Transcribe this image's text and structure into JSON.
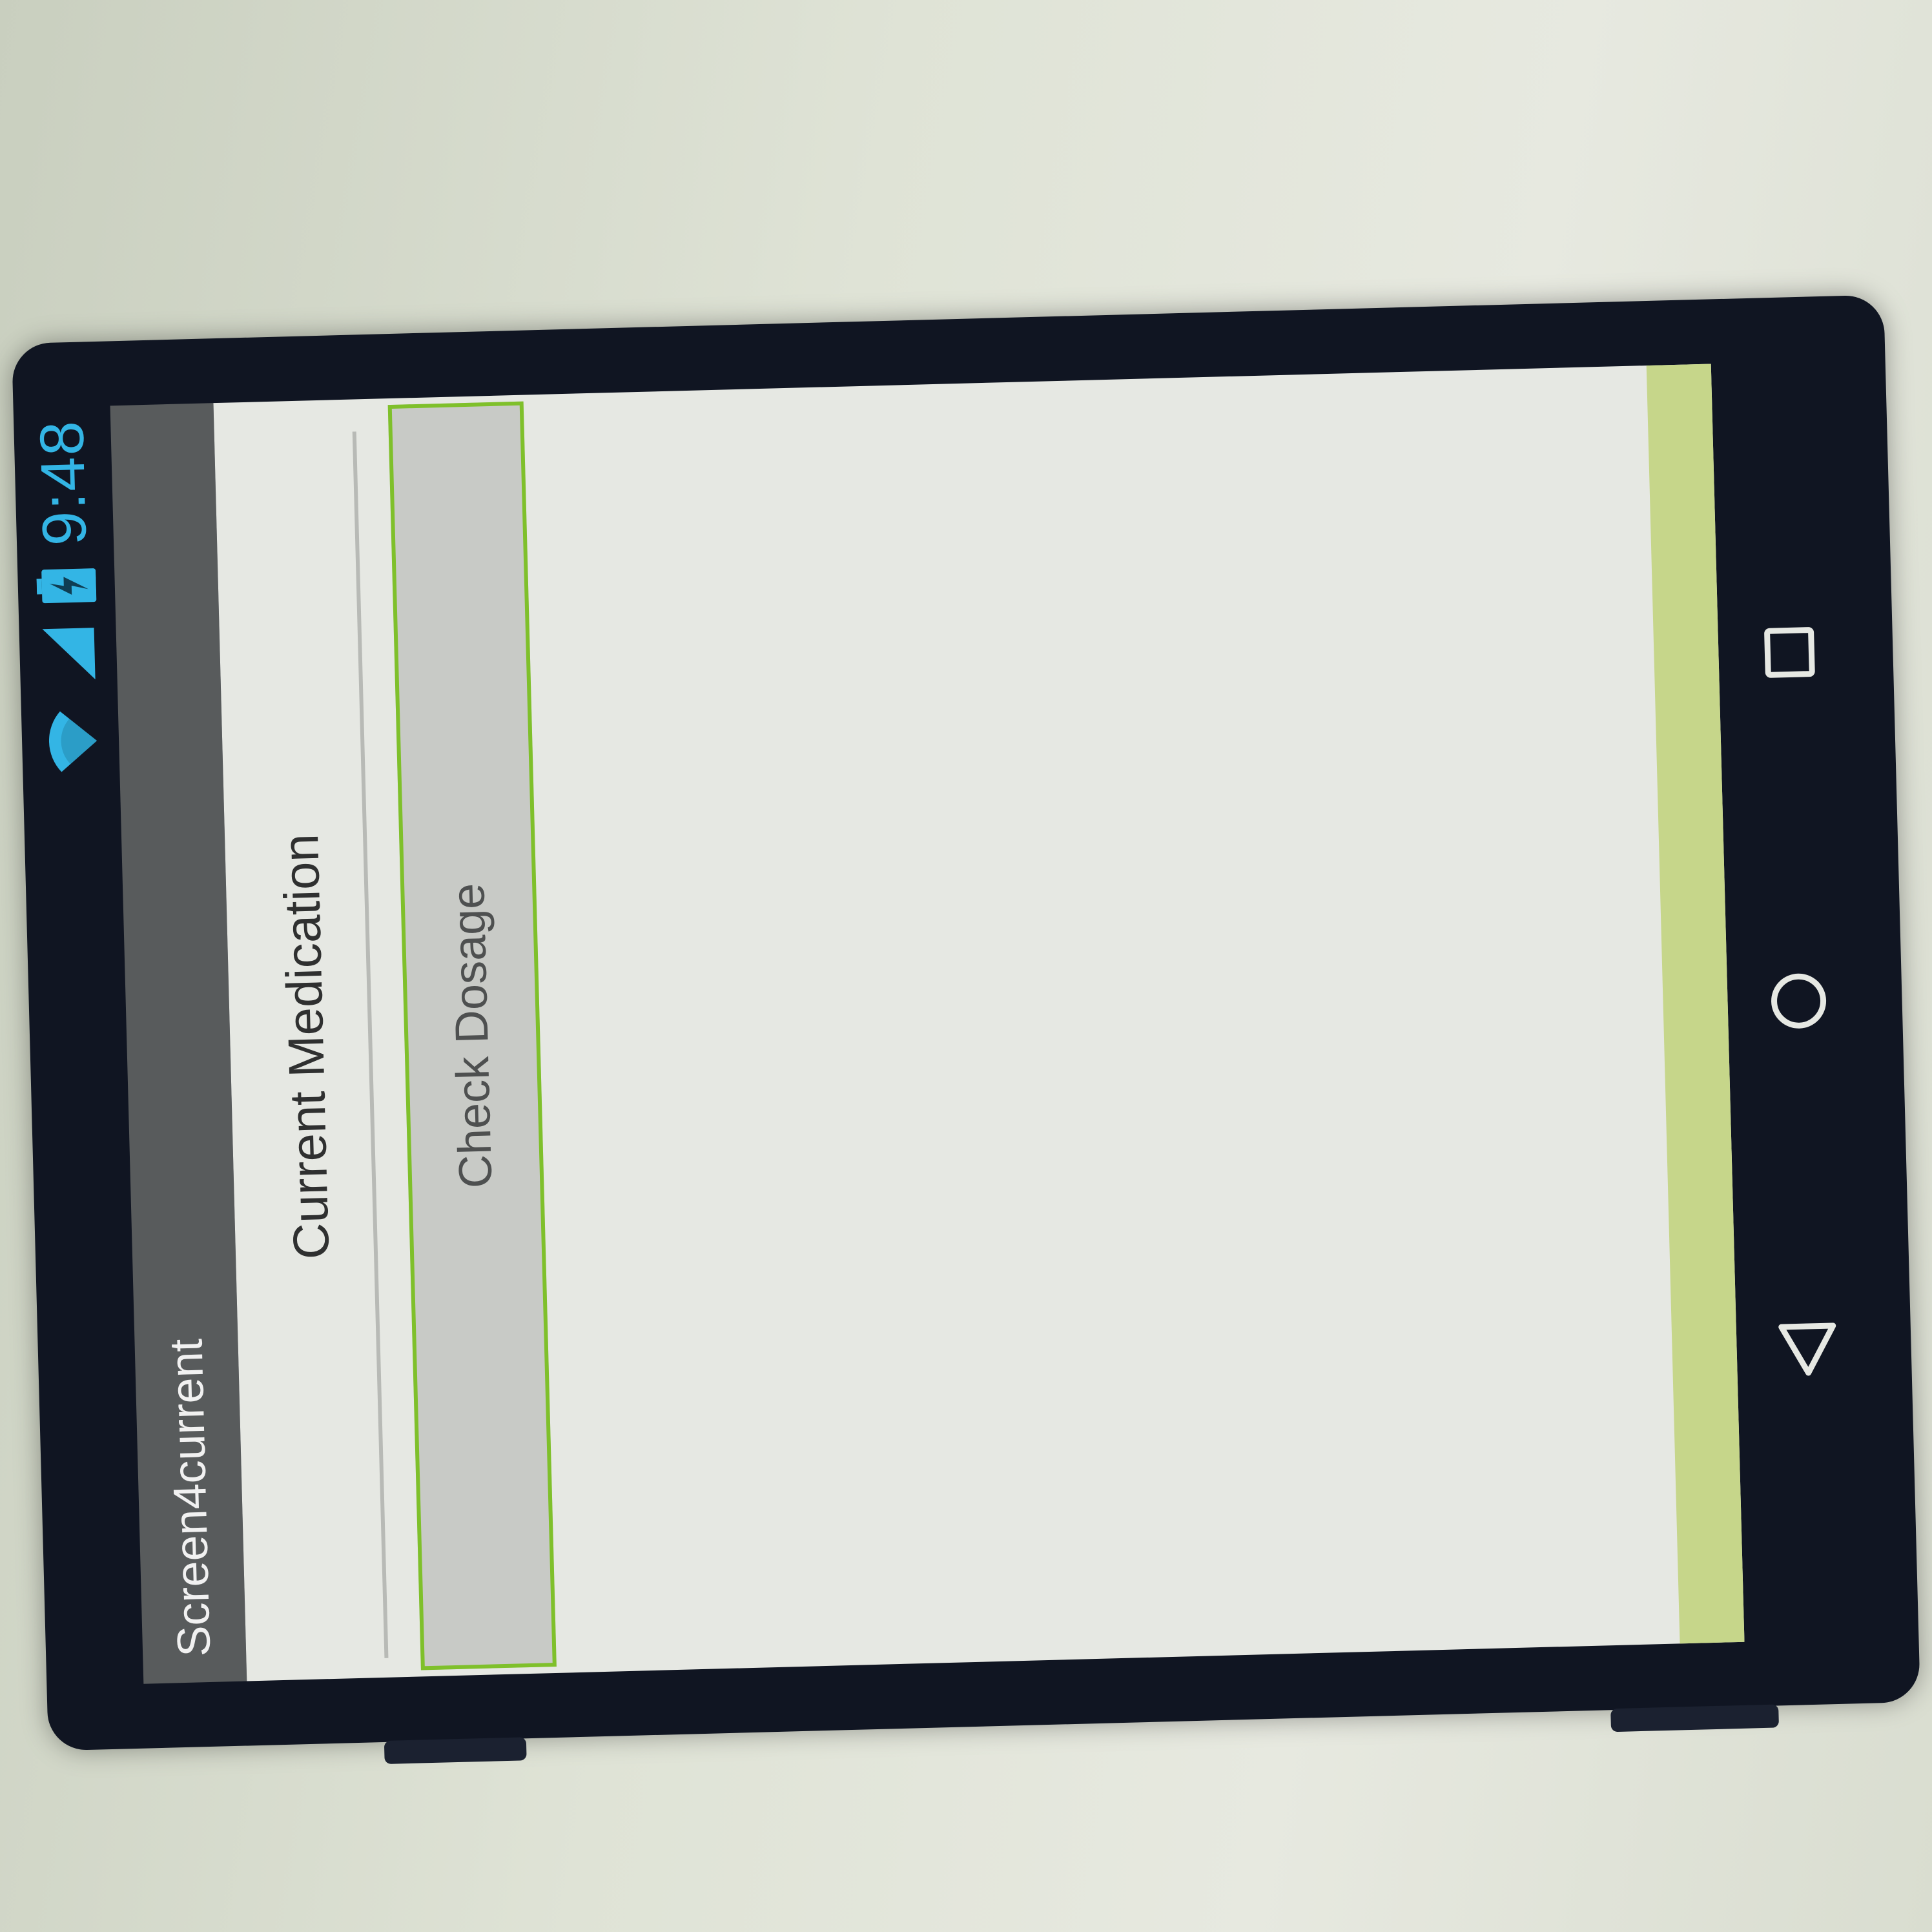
{
  "status_bar": {
    "time": "9:48",
    "icons": [
      "wifi-icon",
      "cell-signal-icon",
      "battery-charging-icon"
    ],
    "accent_color": "#33b5e5"
  },
  "app": {
    "title": "Screen4current"
  },
  "content": {
    "medication_label": "Current Medication",
    "check_dosage_button": "Check Dosage"
  },
  "nav_bar": {
    "buttons": [
      "back-icon",
      "home-icon",
      "recents-icon"
    ]
  },
  "colors": {
    "action_bar": "#585b5c",
    "screen_background": "#e6e8e3",
    "button_border": "#7fc02b",
    "footer_strip": "#c6d68a"
  }
}
